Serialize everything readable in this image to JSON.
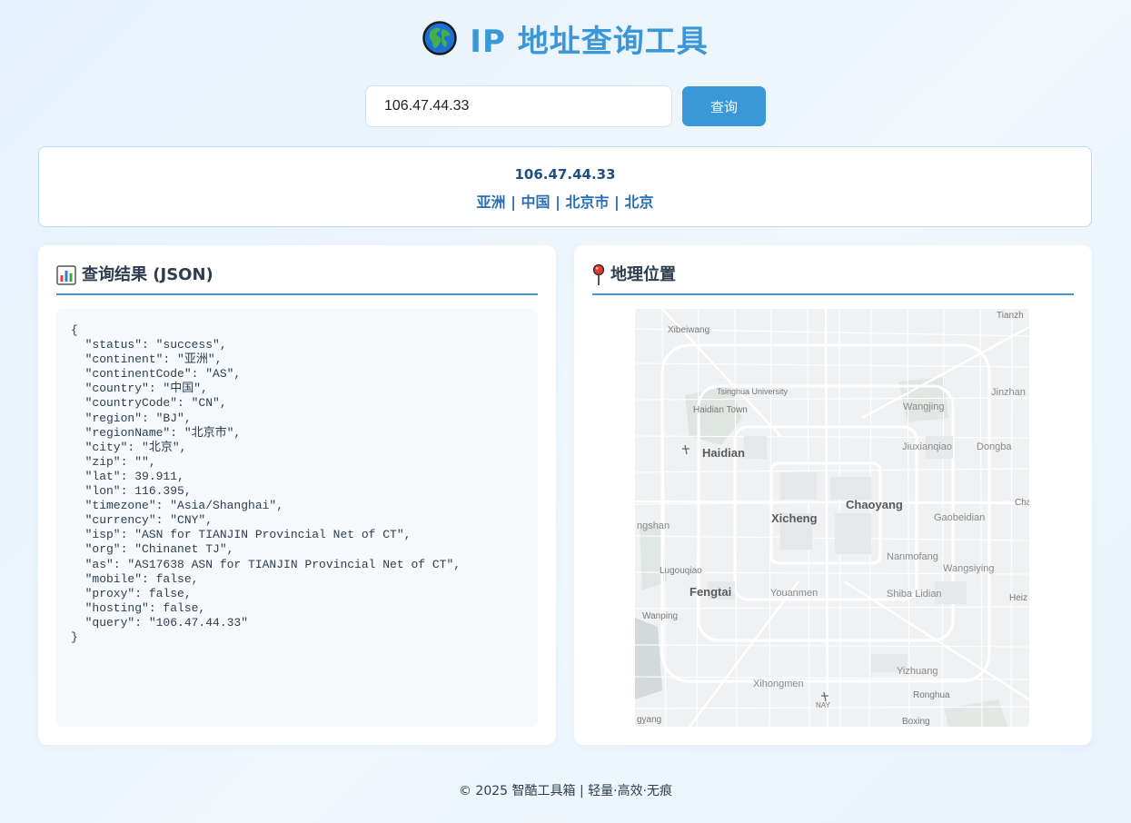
{
  "header": {
    "title": "IP 地址查询工具",
    "icon": "globe-icon"
  },
  "search": {
    "value": "106.47.44.33",
    "button_label": "查询"
  },
  "summary": {
    "ip": "106.47.44.33",
    "location": "亚洲 | 中国 | 北京市 | 北京"
  },
  "json_panel": {
    "title": "查询结果 (JSON)",
    "icon": "bar-chart-icon",
    "content": "{\n  \"status\": \"success\",\n  \"continent\": \"亚洲\",\n  \"continentCode\": \"AS\",\n  \"country\": \"中国\",\n  \"countryCode\": \"CN\",\n  \"region\": \"BJ\",\n  \"regionName\": \"北京市\",\n  \"city\": \"北京\",\n  \"zip\": \"\",\n  \"lat\": 39.911,\n  \"lon\": 116.395,\n  \"timezone\": \"Asia/Shanghai\",\n  \"currency\": \"CNY\",\n  \"isp\": \"ASN for TIANJIN Provincial Net of CT\",\n  \"org\": \"Chinanet TJ\",\n  \"as\": \"AS17638 ASN for TIANJIN Provincial Net of CT\",\n  \"mobile\": false,\n  \"proxy\": false,\n  \"hosting\": false,\n  \"query\": \"106.47.44.33\"\n}"
  },
  "map_panel": {
    "title": "地理位置",
    "icon": "pin-icon",
    "labels": {
      "xibeiwang": "Xibeiwang",
      "tianzh": "Tianzh",
      "tsinghua": "Tsinghua University",
      "haidian_town": "Haidian Town",
      "wangjing": "Wangjing",
      "jinzhan": "Jinzhan",
      "haidian": "Haidian",
      "jiuxianqiao": "Jiuxianqiao",
      "dongba": "Dongba",
      "chaoyang": "Chaoyang",
      "cha": "Cha",
      "xicheng": "Xicheng",
      "gaobeidian": "Gaobeidian",
      "ngshan": "ngshan",
      "nanmofang": "Nanmofang",
      "lugouqiao": "Lugouqiao",
      "wangsiying": "Wangsiying",
      "fengtai": "Fengtai",
      "youanmen": "Youanmen",
      "shiba_lidian": "Shiba Lidian",
      "heiz": "Heiz",
      "wanping": "Wanping",
      "yizhuang": "Yizhuang",
      "xihongmen": "Xihongmen",
      "ronghua": "Ronghua",
      "nay": "NAY",
      "gyang": "gyang",
      "boxing": "Boxing"
    }
  },
  "footer": {
    "text": "© 2025 智酷工具箱 | 轻量·高效·无痕"
  },
  "colors": {
    "accent": "#3a97d8",
    "summary_ip": "#1f4f82",
    "summary_location": "#2a6fb3"
  }
}
